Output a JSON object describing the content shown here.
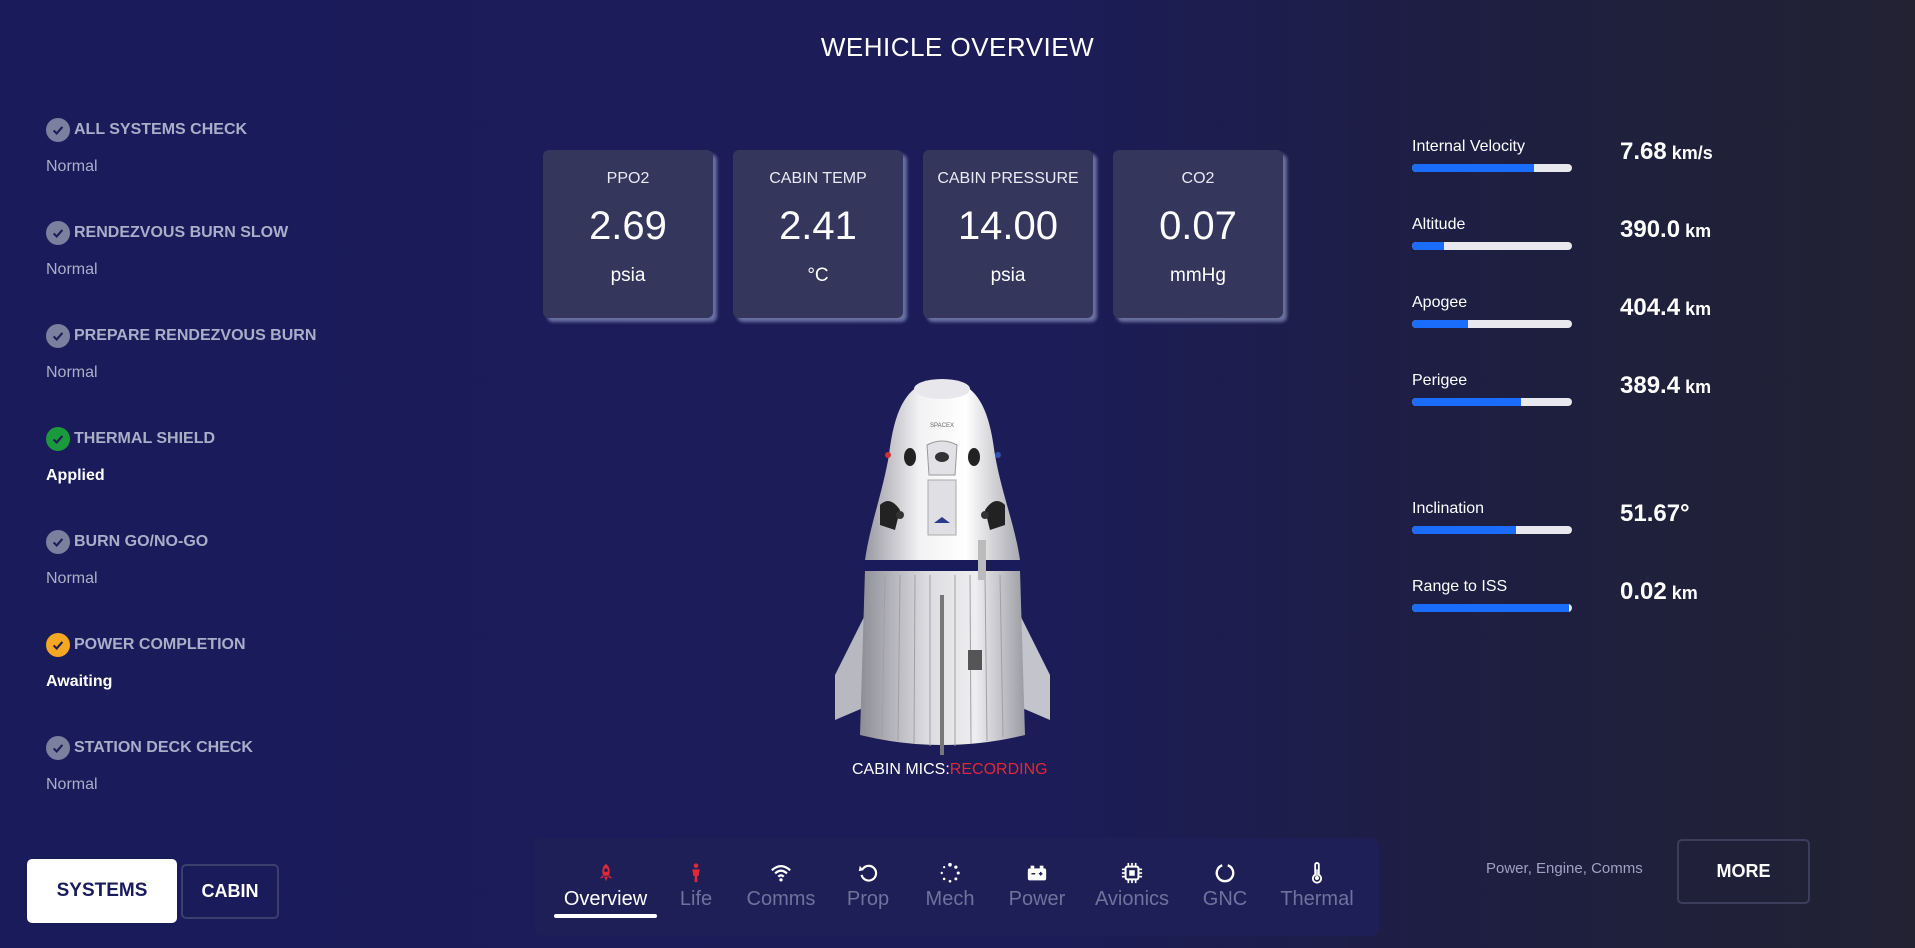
{
  "header": {
    "title": "WEHICLE OVERVIEW"
  },
  "checklist": [
    {
      "title": "ALL SYSTEMS CHECK",
      "status": "Normal",
      "state": "done",
      "icon": "check-icon",
      "color": "#7b809f"
    },
    {
      "title": "RENDEZVOUS BURN SLOW",
      "status": "Normal",
      "state": "done",
      "icon": "check-icon",
      "color": "#7b809f"
    },
    {
      "title": "PREPARE RENDEZVOUS BURN",
      "status": "Normal",
      "state": "done",
      "icon": "check-icon",
      "color": "#7b809f"
    },
    {
      "title": "THERMAL SHIELD",
      "status": "Applied",
      "state": "success",
      "icon": "check-icon",
      "color": "#1a9a3c"
    },
    {
      "title": "BURN GO/NO-GO",
      "status": "Normal",
      "state": "done",
      "icon": "check-icon",
      "color": "#7b809f"
    },
    {
      "title": "POWER COMPLETION",
      "status": "Awaiting",
      "state": "pending",
      "icon": "check-icon",
      "color": "#f5a623"
    },
    {
      "title": "STATION DECK CHECK",
      "status": "Normal",
      "state": "done",
      "icon": "check-icon",
      "color": "#7b809f"
    }
  ],
  "metrics": [
    {
      "label": "PPO2",
      "value": "2.69",
      "unit": "psia"
    },
    {
      "label": "CABIN TEMP",
      "value": "2.41",
      "unit": "°C"
    },
    {
      "label": "CABIN PRESSURE",
      "value": "14.00",
      "unit": "psia"
    },
    {
      "label": "CO2",
      "value": "0.07",
      "unit": "mmHg"
    }
  ],
  "capsule": {
    "mics_label": "CABIN MICS:",
    "mics_status": "RECORDING",
    "logo_text": "SPACEX"
  },
  "telemetry": [
    {
      "label": "Internal Velocity",
      "value": "7.68",
      "unit": "km/s",
      "fill": 0.76
    },
    {
      "label": "Altitude",
      "value": "390.0",
      "unit": "km",
      "fill": 0.2
    },
    {
      "label": "Apogee",
      "value": "404.4",
      "unit": "km",
      "fill": 0.35
    },
    {
      "label": "Perigee",
      "value": "389.4",
      "unit": "km",
      "fill": 0.68
    },
    {
      "label": "Inclination",
      "value": "51.67°",
      "unit": "",
      "fill": 0.65
    },
    {
      "label": "Range to ISS",
      "value": "0.02",
      "unit": "km",
      "fill": 0.98
    }
  ],
  "buttons": {
    "systems": "SYSTEMS",
    "cabin": "CABIN",
    "more": "MORE"
  },
  "more_caption": "Power, Engine, Comms",
  "nav": [
    {
      "label": "Overview",
      "icon": "rocket-icon",
      "active": true
    },
    {
      "label": "Life",
      "icon": "person-icon",
      "active": false
    },
    {
      "label": "Comms",
      "icon": "wifi-icon",
      "active": false
    },
    {
      "label": "Prop",
      "icon": "refresh-icon",
      "active": false
    },
    {
      "label": "Mech",
      "icon": "spinner-icon",
      "active": false
    },
    {
      "label": "Power",
      "icon": "battery-icon",
      "active": false
    },
    {
      "label": "Avionics",
      "icon": "chip-icon",
      "active": false
    },
    {
      "label": "GNC",
      "icon": "circle-icon",
      "active": false
    },
    {
      "label": "Thermal",
      "icon": "thermometer-icon",
      "active": false
    }
  ],
  "colors": {
    "accent": "#1a6dfa",
    "recording": "#e02838",
    "active_nav_icon": "#e02838"
  }
}
